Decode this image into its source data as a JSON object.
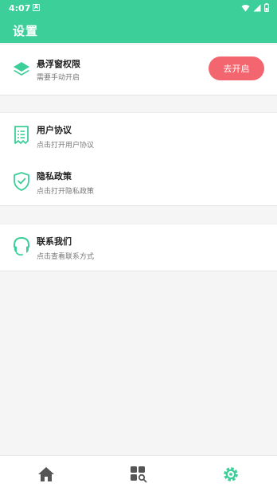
{
  "status_bar": {
    "time": "4:07",
    "app_indicator": "A"
  },
  "app_bar": {
    "title": "设置"
  },
  "sections": {
    "floating": {
      "title": "悬浮窗权限",
      "subtitle": "需要手动开启",
      "button_label": "去开启",
      "icon": "layers-icon"
    },
    "user_agreement": {
      "title": "用户协议",
      "subtitle": "点击打开用户协议",
      "icon": "document-icon"
    },
    "privacy": {
      "title": "隐私政策",
      "subtitle": "点击打开隐私政策",
      "icon": "shield-icon"
    },
    "contact": {
      "title": "联系我们",
      "subtitle": "点击查看联系方式",
      "icon": "headset-icon"
    }
  },
  "bottom_nav": [
    "home-icon",
    "apps-search-icon",
    "settings-icon"
  ],
  "colors": {
    "accent": "#3dcf9a",
    "button": "#f36670",
    "background": "#f5f5f5"
  }
}
